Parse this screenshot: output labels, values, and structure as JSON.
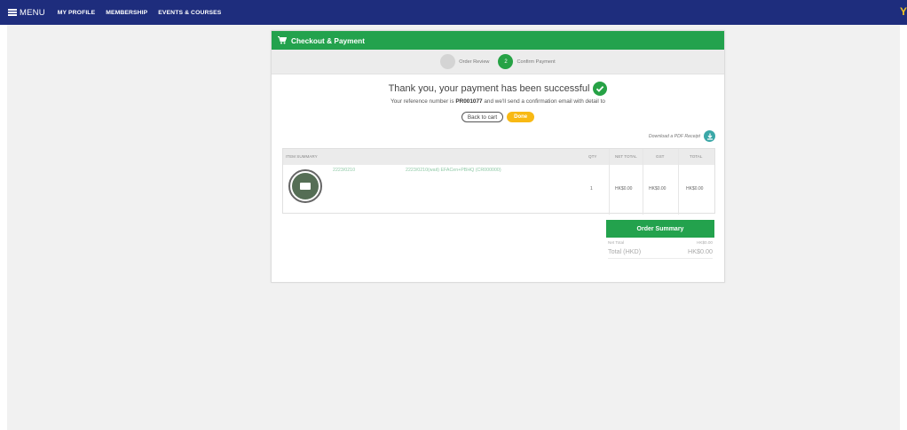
{
  "nav": {
    "menu_label": "MENU",
    "links": [
      "MY PROFILE",
      "MEMBERSHIP",
      "EVENTS & COURSES"
    ],
    "right_glyph": "Y",
    "bg_color": "#1e2d7d"
  },
  "card": {
    "title": "Checkout & Payment",
    "accent_color": "#23a24d"
  },
  "stepper": {
    "steps": [
      {
        "number": "",
        "label": "Order Review",
        "active": false
      },
      {
        "number": "2",
        "label": "Confirm Payment",
        "active": true
      }
    ]
  },
  "confirmation": {
    "message": "Thank you, your payment has been successful",
    "ref_prefix": "Your reference number is",
    "ref_number": "PR001077",
    "ref_suffix": "and we'll send a confirmation email with detail to"
  },
  "buttons": {
    "back_to_cart": "Back to cart",
    "done": "Done"
  },
  "download": {
    "label": "Download a PDF Receipt"
  },
  "table": {
    "headers": {
      "item_summary": "ITEM SUMMARY",
      "qty": "QTY",
      "net_total": "NET TOTAL",
      "gst": "GST",
      "total": "TOTAL"
    },
    "rows": [
      {
        "code": "2223/0210",
        "name": "2223/0210(wait) EFACen+PBHQ (CR000000)",
        "qty": "1",
        "net_total": "HK$0.00",
        "gst": "HK$0.00",
        "total": "HK$0.00"
      }
    ]
  },
  "summary": {
    "title": "Order Summary",
    "net_label": "Net Total",
    "net_value": "HK$0.00",
    "total_label": "Total (HKD)",
    "total_value": "HK$0.00"
  }
}
